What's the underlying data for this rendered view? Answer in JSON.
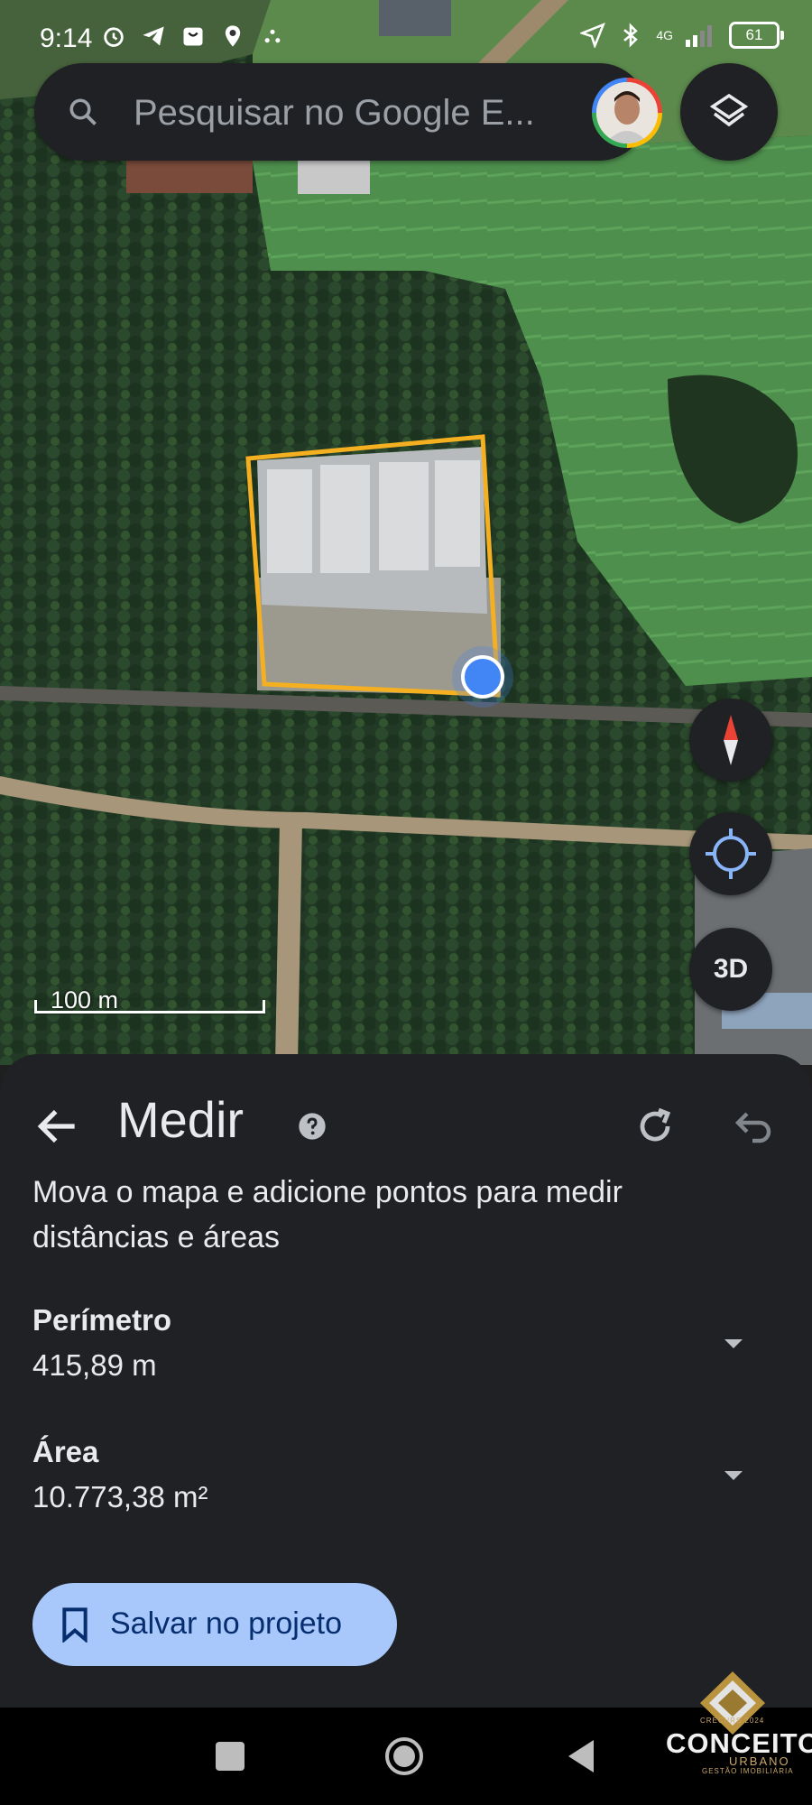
{
  "status_bar": {
    "time": "9:14",
    "network": "4G",
    "battery": "61"
  },
  "search": {
    "placeholder": "Pesquisar no Google E..."
  },
  "map": {
    "scale_label": "100 m",
    "three_d_label": "3D"
  },
  "measure": {
    "title": "Medir",
    "description": "Mova o mapa e adicione pontos para medir distâncias e áreas",
    "perimeter_label": "Perímetro",
    "perimeter_value": "415,89 m",
    "area_label": "Área",
    "area_value": "10.773,38 m²",
    "save_button": "Salvar no projeto"
  },
  "watermark": {
    "top_line": "CRECI/RS 2024",
    "brand": "CONCEITO",
    "brand_sub": "URBANO",
    "tagline": "GESTÃO IMOBILIÁRIA"
  },
  "colors": {
    "polygon": "#f5b021",
    "location_dot": "#4285f4",
    "save_button_bg": "#a8c7fa",
    "sheet_bg": "#202124"
  }
}
